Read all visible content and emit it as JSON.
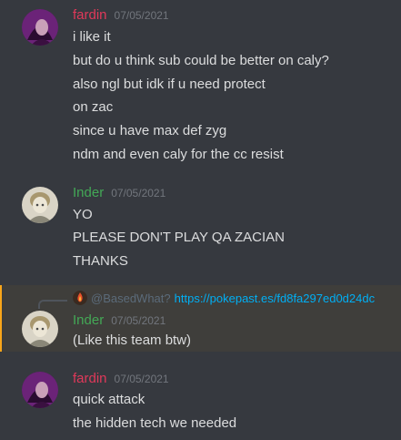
{
  "colors": {
    "background": "#36393f",
    "fardin_name": "#e0395a",
    "inder_name": "#43a856",
    "timestamp": "#72767d",
    "link": "#00aff4",
    "highlight_bar": "#faa61a"
  },
  "messages": [
    {
      "author": "fardin",
      "timestamp": "07/05/2021",
      "lines": [
        "i like it",
        "but do u think sub could be better on caly?",
        "also ngl but idk if u need protect",
        "on zac",
        "since u have max def zyg",
        "ndm and even caly for the cc resist"
      ]
    },
    {
      "author": "Inder",
      "timestamp": "07/05/2021",
      "lines": [
        "YO",
        "PLEASE DON'T PLAY QA ZACIAN",
        "THANKS"
      ]
    },
    {
      "reply": {
        "author": "@BasedWhat?",
        "link": "https://pokepast.es/fd8fa297ed0d24dc"
      },
      "author": "Inder",
      "timestamp": "07/05/2021",
      "lines": [
        "(Like this team btw)"
      ]
    },
    {
      "author": "fardin",
      "timestamp": "07/05/2021",
      "lines": [
        "quick attack",
        "the hidden tech we needed"
      ]
    }
  ],
  "icons": {
    "fardin_avatar": "avatar-purple-portrait-icon",
    "inder_avatar": "avatar-sketch-portrait-icon",
    "reply_avatar": "avatar-fire-icon"
  }
}
